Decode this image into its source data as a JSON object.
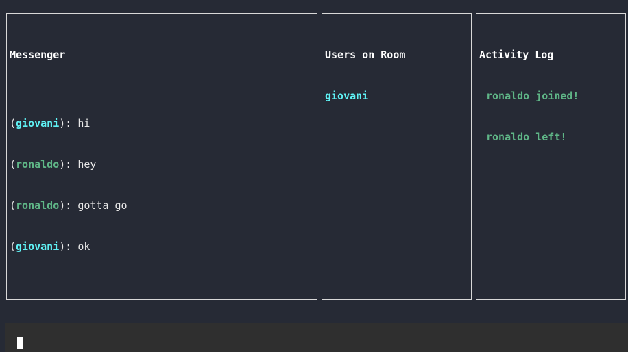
{
  "messenger": {
    "title": "Messenger",
    "messages": [
      {
        "user": "giovani",
        "text": "hi"
      },
      {
        "user": "ronaldo",
        "text": "hey"
      },
      {
        "user": "ronaldo",
        "text": "gotta go"
      },
      {
        "user": "giovani",
        "text": "ok"
      }
    ]
  },
  "users": {
    "title": "Users on Room",
    "list": [
      "giovani"
    ]
  },
  "activity": {
    "title": "Activity Log",
    "entries": [
      "ronaldo joined!",
      "ronaldo left!"
    ]
  },
  "colors": {
    "background": "#262a35",
    "user_giovani": "#5ff2f5",
    "user_ronaldo": "#5fb687",
    "border": "#d8d8d8",
    "input_bar": "#2f2f2f"
  },
  "input": {
    "value": ""
  }
}
